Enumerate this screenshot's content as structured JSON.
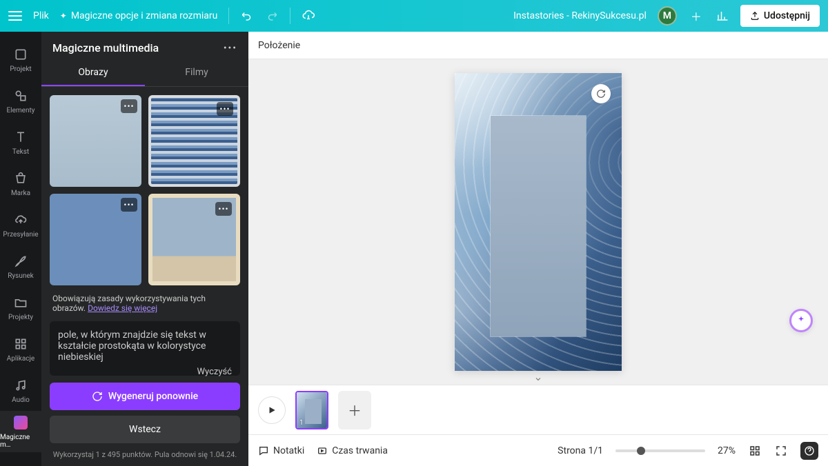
{
  "topbar": {
    "file": "Plik",
    "magic": "Magiczne opcje i zmiana rozmiaru",
    "doc_title": "Instastories - RekinySukcesu.pl",
    "avatar_initial": "M",
    "share": "Udostępnij"
  },
  "sidebar": {
    "items": [
      {
        "label": "Projekt"
      },
      {
        "label": "Elementy"
      },
      {
        "label": "Tekst"
      },
      {
        "label": "Marka"
      },
      {
        "label": "Przesyłanie"
      },
      {
        "label": "Rysunek"
      },
      {
        "label": "Projekty"
      },
      {
        "label": "Aplikacje"
      },
      {
        "label": "Audio"
      },
      {
        "label": "Magiczne m…"
      }
    ]
  },
  "panel": {
    "title": "Magiczne multimedia",
    "tabs": {
      "images": "Obrazy",
      "videos": "Filmy"
    },
    "usage_note": "Obowiązują zasady wykorzystywania tych obrazów.",
    "usage_link": "Dowiedz się więcej",
    "prompt": "pole, w którym znajdzie się tekst w kształcie prostokąta w kolorystyce niebieskiej",
    "clear": "Wyczyść",
    "generate": "Wygeneruj ponownie",
    "back": "Wstecz",
    "credits": "Wykorzystaj 1 z 495 punktów. Pula odnowi się 1.04.24."
  },
  "canvas": {
    "toolbar": "Położenie"
  },
  "pages": {
    "page_num": "1"
  },
  "bottombar": {
    "notes": "Notatki",
    "duration": "Czas trwania",
    "page_counter": "Strona 1/1",
    "zoom": "27%"
  }
}
